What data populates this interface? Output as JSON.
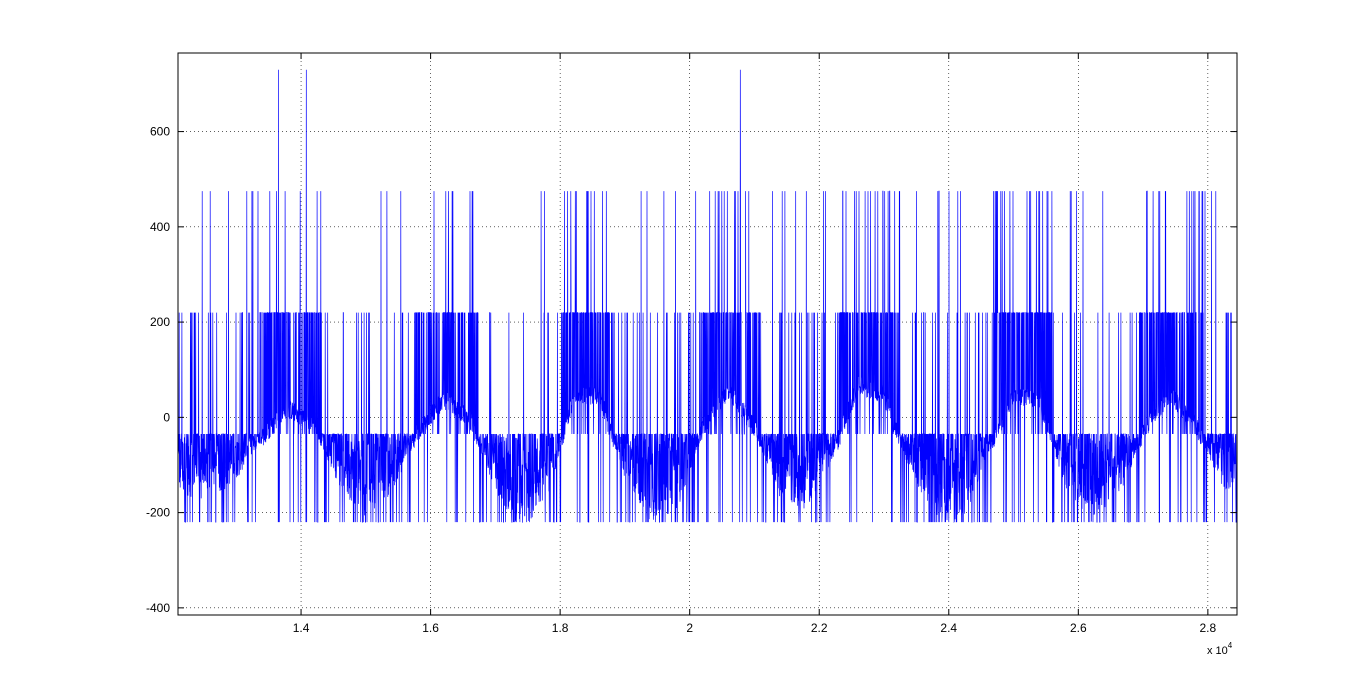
{
  "figure": {
    "background": "#ffffff"
  },
  "chart_data": {
    "type": "line",
    "title": "",
    "xlabel": "",
    "ylabel": "",
    "x_exponent_label": "x 10",
    "x_exponent_power": "4",
    "xlim": [
      1.21,
      2.845
    ],
    "ylim": [
      -415,
      765
    ],
    "x_scale_note": "x values are in units of 10^4",
    "grid": true,
    "grid_style": "dotted",
    "line_color": "#0000ff",
    "xticks": [
      1.4,
      1.6,
      1.8,
      2.0,
      2.2,
      2.4,
      2.6,
      2.8
    ],
    "xtick_labels": [
      "1.4",
      "1.6",
      "1.8",
      "2",
      "2.2",
      "2.4",
      "2.6",
      "2.8"
    ],
    "yticks": [
      -400,
      -200,
      0,
      200,
      400,
      600
    ],
    "ytick_labels": [
      "-400",
      "-200",
      "0",
      "200",
      "400",
      "600"
    ],
    "envelope": {
      "description": "approximate lower-envelope sinusoid of the noisy signal",
      "x": [
        1.21,
        1.26,
        1.3,
        1.34,
        1.38,
        1.42,
        1.46,
        1.5,
        1.54,
        1.58,
        1.62,
        1.66,
        1.7,
        1.74,
        1.78,
        1.82,
        1.86,
        1.9,
        1.94,
        1.98,
        2.02,
        2.06,
        2.1,
        2.14,
        2.18,
        2.22,
        2.26,
        2.3,
        2.34,
        2.38,
        2.42,
        2.46,
        2.5,
        2.54,
        2.58,
        2.62,
        2.66,
        2.7,
        2.74,
        2.78,
        2.82,
        2.845
      ],
      "y": [
        -160,
        -180,
        -130,
        -50,
        10,
        -20,
        -150,
        -210,
        -160,
        -40,
        30,
        -10,
        -160,
        -240,
        -170,
        30,
        40,
        -130,
        -220,
        -200,
        -30,
        50,
        -30,
        -170,
        -200,
        -90,
        60,
        40,
        -120,
        -210,
        -230,
        -80,
        40,
        30,
        -150,
        -220,
        -180,
        -40,
        40,
        -20,
        -140,
        -180
      ]
    },
    "spike_levels": [
      -220,
      -35,
      220,
      475,
      730
    ],
    "tall_spikes_x": [
      1.365,
      1.408,
      2.078
    ],
    "tall_spike_value": 730,
    "pattern": "dense switching between approximately -220, -35, 220 and 475 with sinusoidal modulation (period ~0.45e4)"
  }
}
